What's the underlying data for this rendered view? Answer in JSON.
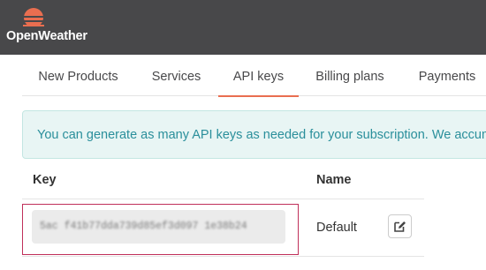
{
  "header": {
    "brand": "OpenWeather",
    "logo_icon": "sun-logo-icon",
    "brand_color": "#e96e50",
    "background": "#48484a"
  },
  "tabs": [
    {
      "label": "New Products",
      "active": false
    },
    {
      "label": "Services",
      "active": false
    },
    {
      "label": "API keys",
      "active": true
    },
    {
      "label": "Billing plans",
      "active": false
    },
    {
      "label": "Payments",
      "active": false
    }
  ],
  "alert": {
    "text": "You can generate as many API keys as needed for your subscription. We accumulate the calls from all of them."
  },
  "keys_table": {
    "columns": {
      "key": "Key",
      "name": "Name"
    },
    "rows": [
      {
        "key": "5ac f41b77dda739d85ef3d097 1e38b24",
        "key_blurred": true,
        "name": "Default",
        "edit_icon": "edit-icon"
      }
    ]
  },
  "colors": {
    "accent": "#e96e50",
    "alert_text": "#2a8f9b",
    "alert_bg": "#e8f5f4",
    "highlight_border": "#c0305a"
  }
}
